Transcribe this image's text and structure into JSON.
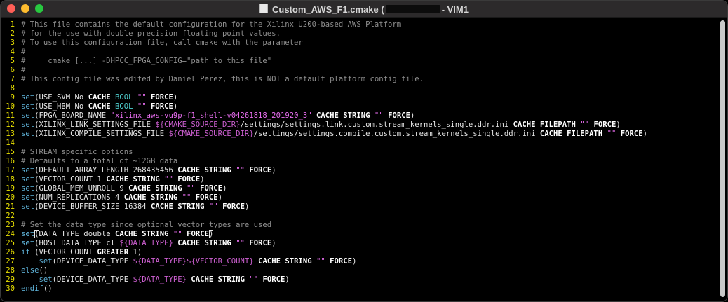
{
  "window": {
    "title_prefix": "Custom_AWS_F1.cmake (",
    "title_suffix": "- VIM1"
  },
  "colors": {
    "line_number": "#e8e000",
    "comment": "#8f8f8f",
    "keyword": "#5fb3d9",
    "string": "#e86ef0",
    "bool": "#4fd0d0"
  },
  "editor": {
    "lines": [
      {
        "n": "1",
        "segs": [
          {
            "c": "c",
            "t": "# This file contains the default configuration for the Xilinx U200-based AWS Platform"
          }
        ]
      },
      {
        "n": "2",
        "segs": [
          {
            "c": "c",
            "t": "# for the use with double precision floating point values."
          }
        ]
      },
      {
        "n": "3",
        "segs": [
          {
            "c": "c",
            "t": "# To use this configuration file, call cmake with the parameter"
          }
        ]
      },
      {
        "n": "4",
        "segs": [
          {
            "c": "c",
            "t": "#"
          }
        ]
      },
      {
        "n": "5",
        "segs": [
          {
            "c": "c",
            "t": "#     cmake [...] -DHPCC_FPGA_CONFIG=\"path to this file\""
          }
        ]
      },
      {
        "n": "6",
        "segs": [
          {
            "c": "c",
            "t": "#"
          }
        ]
      },
      {
        "n": "7",
        "segs": [
          {
            "c": "c",
            "t": "# This config file was edited by Daniel Perez, this is NOT a default platform config file."
          }
        ]
      },
      {
        "n": "8",
        "segs": []
      },
      {
        "n": "9",
        "segs": [
          {
            "c": "k",
            "t": "set"
          },
          {
            "c": "p",
            "t": "(USE_SVM No "
          },
          {
            "c": "b",
            "t": "CACHE"
          },
          {
            "c": "p",
            "t": " "
          },
          {
            "c": "t",
            "t": "BOOL"
          },
          {
            "c": "p",
            "t": " "
          },
          {
            "c": "s",
            "t": "\"\""
          },
          {
            "c": "p",
            "t": " "
          },
          {
            "c": "b",
            "t": "FORCE"
          },
          {
            "c": "p",
            "t": ")"
          }
        ]
      },
      {
        "n": "10",
        "segs": [
          {
            "c": "k",
            "t": "set"
          },
          {
            "c": "p",
            "t": "(USE_HBM No "
          },
          {
            "c": "b",
            "t": "CACHE"
          },
          {
            "c": "p",
            "t": " "
          },
          {
            "c": "t",
            "t": "BOOL"
          },
          {
            "c": "p",
            "t": " "
          },
          {
            "c": "s",
            "t": "\"\""
          },
          {
            "c": "p",
            "t": " "
          },
          {
            "c": "b",
            "t": "FORCE"
          },
          {
            "c": "p",
            "t": ")"
          }
        ]
      },
      {
        "n": "11",
        "segs": [
          {
            "c": "k",
            "t": "set"
          },
          {
            "c": "p",
            "t": "(FPGA_BOARD_NAME "
          },
          {
            "c": "s",
            "t": "\"xilinx_aws-vu9p-f1_shell-v04261818_201920_3\""
          },
          {
            "c": "p",
            "t": " "
          },
          {
            "c": "b",
            "t": "CACHE STRING"
          },
          {
            "c": "p",
            "t": " "
          },
          {
            "c": "s",
            "t": "\"\""
          },
          {
            "c": "p",
            "t": " "
          },
          {
            "c": "b",
            "t": "FORCE"
          },
          {
            "c": "p",
            "t": ")"
          }
        ]
      },
      {
        "n": "12",
        "segs": [
          {
            "c": "k",
            "t": "set"
          },
          {
            "c": "p",
            "t": "(XILINX_LINK_SETTINGS_FILE "
          },
          {
            "c": "v",
            "t": "${CMAKE_SOURCE_DIR}"
          },
          {
            "c": "p",
            "t": "/settings/settings.link.custom.stream_kernels_single.ddr.ini "
          },
          {
            "c": "b",
            "t": "CACHE FILEPATH"
          },
          {
            "c": "p",
            "t": " "
          },
          {
            "c": "s",
            "t": "\"\""
          },
          {
            "c": "p",
            "t": " "
          },
          {
            "c": "b",
            "t": "FORCE"
          },
          {
            "c": "p",
            "t": ")"
          }
        ]
      },
      {
        "n": "13",
        "segs": [
          {
            "c": "k",
            "t": "set"
          },
          {
            "c": "p",
            "t": "(XILINX_COMPILE_SETTINGS_FILE "
          },
          {
            "c": "v",
            "t": "${CMAKE_SOURCE_DIR}"
          },
          {
            "c": "p",
            "t": "/settings/settings.compile.custom.stream_kernels_single.ddr.ini "
          },
          {
            "c": "b",
            "t": "CACHE FILEPATH"
          },
          {
            "c": "p",
            "t": " "
          },
          {
            "c": "s",
            "t": "\"\""
          },
          {
            "c": "p",
            "t": " "
          },
          {
            "c": "b",
            "t": "FORCE"
          },
          {
            "c": "p",
            "t": ")"
          }
        ]
      },
      {
        "n": "14",
        "segs": []
      },
      {
        "n": "15",
        "segs": [
          {
            "c": "c",
            "t": "# STREAM specific options"
          }
        ]
      },
      {
        "n": "16",
        "segs": [
          {
            "c": "c",
            "t": "# Defaults to a total of ~12GB data"
          }
        ]
      },
      {
        "n": "17",
        "segs": [
          {
            "c": "k",
            "t": "set"
          },
          {
            "c": "p",
            "t": "(DEFAULT_ARRAY_LENGTH 268435456 "
          },
          {
            "c": "b",
            "t": "CACHE STRING"
          },
          {
            "c": "p",
            "t": " "
          },
          {
            "c": "s",
            "t": "\"\""
          },
          {
            "c": "p",
            "t": " "
          },
          {
            "c": "b",
            "t": "FORCE"
          },
          {
            "c": "p",
            "t": ")"
          }
        ]
      },
      {
        "n": "18",
        "segs": [
          {
            "c": "k",
            "t": "set"
          },
          {
            "c": "p",
            "t": "(VECTOR_COUNT 1 "
          },
          {
            "c": "b",
            "t": "CACHE STRING"
          },
          {
            "c": "p",
            "t": " "
          },
          {
            "c": "s",
            "t": "\"\""
          },
          {
            "c": "p",
            "t": " "
          },
          {
            "c": "b",
            "t": "FORCE"
          },
          {
            "c": "p",
            "t": ")"
          }
        ]
      },
      {
        "n": "19",
        "segs": [
          {
            "c": "k",
            "t": "set"
          },
          {
            "c": "p",
            "t": "(GLOBAL_MEM_UNROLL 9 "
          },
          {
            "c": "b",
            "t": "CACHE STRING"
          },
          {
            "c": "p",
            "t": " "
          },
          {
            "c": "s",
            "t": "\"\""
          },
          {
            "c": "p",
            "t": " "
          },
          {
            "c": "b",
            "t": "FORCE"
          },
          {
            "c": "p",
            "t": ")"
          }
        ]
      },
      {
        "n": "20",
        "segs": [
          {
            "c": "k",
            "t": "set"
          },
          {
            "c": "p",
            "t": "(NUM_REPLICATIONS 4 "
          },
          {
            "c": "b",
            "t": "CACHE STRING"
          },
          {
            "c": "p",
            "t": " "
          },
          {
            "c": "s",
            "t": "\"\""
          },
          {
            "c": "p",
            "t": " "
          },
          {
            "c": "b",
            "t": "FORCE"
          },
          {
            "c": "p",
            "t": ")"
          }
        ]
      },
      {
        "n": "21",
        "segs": [
          {
            "c": "k",
            "t": "set"
          },
          {
            "c": "p",
            "t": "(DEVICE_BUFFER_SIZE 16384 "
          },
          {
            "c": "b",
            "t": "CACHE STRING"
          },
          {
            "c": "p",
            "t": " "
          },
          {
            "c": "s",
            "t": "\"\""
          },
          {
            "c": "p",
            "t": " "
          },
          {
            "c": "b",
            "t": "FORCE"
          },
          {
            "c": "p",
            "t": ")"
          }
        ]
      },
      {
        "n": "22",
        "segs": []
      },
      {
        "n": "23",
        "segs": [
          {
            "c": "c",
            "t": "# Set the data type since optional vector types are used"
          }
        ]
      },
      {
        "n": "24",
        "segs": [
          {
            "c": "k",
            "t": "set"
          },
          {
            "c": "p cursor",
            "t": "("
          },
          {
            "c": "p",
            "t": "DATA_TYPE double "
          },
          {
            "c": "b",
            "t": "CACHE STRING"
          },
          {
            "c": "p",
            "t": " "
          },
          {
            "c": "s",
            "t": "\"\""
          },
          {
            "c": "p",
            "t": " "
          },
          {
            "c": "b",
            "t": "FORCE"
          },
          {
            "c": "p cursor",
            "t": ")"
          }
        ]
      },
      {
        "n": "25",
        "segs": [
          {
            "c": "k",
            "t": "set"
          },
          {
            "c": "p",
            "t": "(HOST_DATA_TYPE cl_"
          },
          {
            "c": "v",
            "t": "${DATA_TYPE}"
          },
          {
            "c": "p",
            "t": " "
          },
          {
            "c": "b",
            "t": "CACHE STRING"
          },
          {
            "c": "p",
            "t": " "
          },
          {
            "c": "s",
            "t": "\"\""
          },
          {
            "c": "p",
            "t": " "
          },
          {
            "c": "b",
            "t": "FORCE"
          },
          {
            "c": "p",
            "t": ")"
          }
        ]
      },
      {
        "n": "26",
        "segs": [
          {
            "c": "k",
            "t": "if"
          },
          {
            "c": "p",
            "t": " (VECTOR_COUNT "
          },
          {
            "c": "b",
            "t": "GREATER"
          },
          {
            "c": "p",
            "t": " 1)"
          }
        ]
      },
      {
        "n": "27",
        "segs": [
          {
            "c": "p",
            "t": "    "
          },
          {
            "c": "k",
            "t": "set"
          },
          {
            "c": "p",
            "t": "(DEVICE_DATA_TYPE "
          },
          {
            "c": "v",
            "t": "${DATA_TYPE}${VECTOR_COUNT}"
          },
          {
            "c": "p",
            "t": " "
          },
          {
            "c": "b",
            "t": "CACHE STRING"
          },
          {
            "c": "p",
            "t": " "
          },
          {
            "c": "s",
            "t": "\"\""
          },
          {
            "c": "p",
            "t": " "
          },
          {
            "c": "b",
            "t": "FORCE"
          },
          {
            "c": "p",
            "t": ")"
          }
        ]
      },
      {
        "n": "28",
        "segs": [
          {
            "c": "k",
            "t": "else"
          },
          {
            "c": "p",
            "t": "()"
          }
        ]
      },
      {
        "n": "29",
        "segs": [
          {
            "c": "p",
            "t": "    "
          },
          {
            "c": "k",
            "t": "set"
          },
          {
            "c": "p",
            "t": "(DEVICE_DATA_TYPE "
          },
          {
            "c": "v",
            "t": "${DATA_TYPE}"
          },
          {
            "c": "p",
            "t": " "
          },
          {
            "c": "b",
            "t": "CACHE STRING"
          },
          {
            "c": "p",
            "t": " "
          },
          {
            "c": "s",
            "t": "\"\""
          },
          {
            "c": "p",
            "t": " "
          },
          {
            "c": "b",
            "t": "FORCE"
          },
          {
            "c": "p",
            "t": ")"
          }
        ]
      },
      {
        "n": "30",
        "segs": [
          {
            "c": "k",
            "t": "endif"
          },
          {
            "c": "p",
            "t": "()"
          }
        ]
      }
    ]
  }
}
